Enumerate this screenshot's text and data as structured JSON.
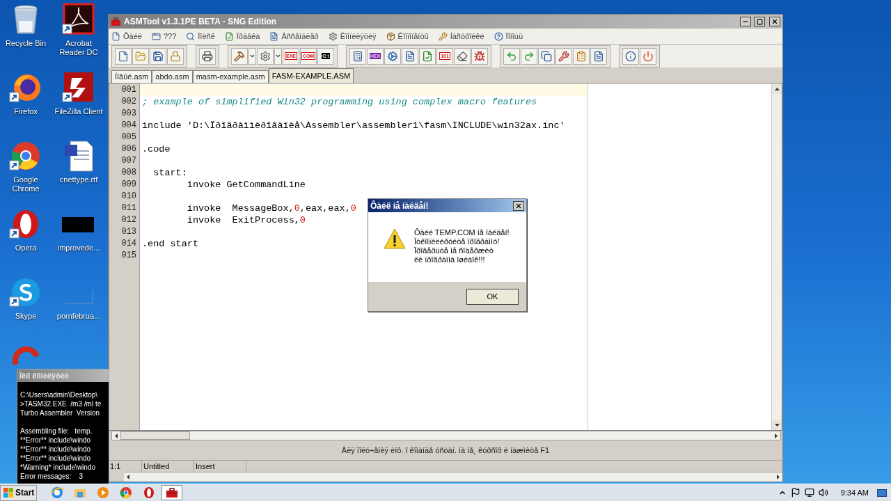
{
  "desktop_icons": [
    {
      "kind": "recycle-bin",
      "label": "Recycle Bin",
      "shortcut": false
    },
    {
      "kind": "pdf",
      "label": "Acrobat Reader DC",
      "shortcut": true
    },
    {
      "kind": "firefox",
      "label": "Firefox",
      "shortcut": true
    },
    {
      "kind": "filezilla",
      "label": "FileZilla Client",
      "shortcut": true
    },
    {
      "kind": "chrome",
      "label": "Google Chrome",
      "shortcut": true
    },
    {
      "kind": "word",
      "label": "cnettype.rtf",
      "shortcut": false
    },
    {
      "kind": "opera",
      "label": "Opera",
      "shortcut": true
    },
    {
      "kind": "black-file",
      "label": "improvede...",
      "shortcut": false
    },
    {
      "kind": "skype",
      "label": "Skype",
      "shortcut": true
    },
    {
      "kind": "blank-file",
      "label": "pornfebrua...",
      "shortcut": false
    },
    {
      "kind": "cleaner"
    }
  ],
  "editor_window": {
    "title": "ASMTool v1.3.1PE BETA - SNG Edition",
    "menu": [
      {
        "kind": "file",
        "label": "Ôàéë"
      },
      {
        "kind": "window",
        "label": "???"
      },
      {
        "kind": "search",
        "label": "Ïîèñê"
      },
      {
        "kind": "edit",
        "label": "Ïðàâêà"
      },
      {
        "kind": "assembler",
        "label": "Àññåìáëåð"
      },
      {
        "kind": "compile",
        "label": "Êîìïèëÿöèÿ"
      },
      {
        "kind": "components",
        "label": "Êîìïîíåíòû"
      },
      {
        "kind": "tools",
        "label": "Íàñòðîéêè"
      },
      {
        "kind": "help",
        "label": "Ïîìîùü"
      }
    ],
    "toolbar": [
      [
        {
          "kind": "new"
        },
        {
          "kind": "open"
        },
        {
          "kind": "save"
        },
        {
          "kind": "properties"
        }
      ],
      [
        {
          "kind": "print"
        }
      ],
      [
        {
          "kind": "build"
        },
        {
          "kind": "dropdown"
        },
        {
          "kind": "settings"
        },
        {
          "kind": "dropdown"
        },
        {
          "kind": "exe",
          "label": "EXE"
        },
        {
          "kind": "com",
          "label": "COM"
        },
        {
          "kind": "console",
          "label": "C:\\"
        }
      ],
      [
        {
          "kind": "calculator"
        },
        {
          "kind": "hex",
          "label": "HEX"
        },
        {
          "kind": "gear"
        },
        {
          "kind": "document"
        },
        {
          "kind": "check"
        },
        {
          "kind": "binary",
          "label": "101"
        },
        {
          "kind": "eraser"
        },
        {
          "kind": "bug"
        }
      ],
      [
        {
          "kind": "undo"
        },
        {
          "kind": "redo"
        },
        {
          "kind": "copy"
        },
        {
          "kind": "tools"
        },
        {
          "kind": "clipboard"
        },
        {
          "kind": "document"
        }
      ],
      [
        {
          "kind": "info"
        },
        {
          "kind": "power"
        }
      ]
    ],
    "tabs": [
      {
        "label": "Íîâûé.asm",
        "selected": false
      },
      {
        "label": "abdo.asm",
        "selected": false
      },
      {
        "label": "masm-example.asm",
        "selected": false
      },
      {
        "label": "FASM-EXAMPLE.ASM",
        "selected": true
      }
    ],
    "lines": [
      {
        "number": "001",
        "current": true
      },
      {
        "number": "002",
        "current": false,
        "tokens": [
          {
            "kind": "comment",
            "text": "; example of simplified Win32 programming using complex macro features"
          }
        ]
      },
      {
        "number": "003",
        "current": false
      },
      {
        "number": "004",
        "current": false,
        "tokens": [
          {
            "kind": "plain",
            "text": "include 'D:\\Ïðîãðàììèðîâàíèå\\Assembler\\assembler1\\fasm\\INCLUDE\\win32ax.inc'"
          }
        ]
      },
      {
        "number": "005",
        "current": false
      },
      {
        "number": "006",
        "current": false,
        "tokens": [
          {
            "kind": "plain",
            "text": ".code"
          }
        ]
      },
      {
        "number": "007",
        "current": false
      },
      {
        "number": "008",
        "current": false,
        "tokens": [
          {
            "kind": "plain",
            "text": "  start:"
          }
        ]
      },
      {
        "number": "009",
        "current": false,
        "tokens": [
          {
            "kind": "plain",
            "text": "        invoke GetCommandLine"
          }
        ]
      },
      {
        "number": "010",
        "current": false
      },
      {
        "number": "011",
        "current": false,
        "tokens": [
          {
            "kind": "plain",
            "text": "        invoke  MessageBox,"
          },
          {
            "kind": "number",
            "text": "0"
          },
          {
            "kind": "plain",
            "text": ",eax,eax,"
          },
          {
            "kind": "number",
            "text": "0"
          }
        ]
      },
      {
        "number": "012",
        "current": false,
        "tokens": [
          {
            "kind": "plain",
            "text": "        invoke  ExitProcess,"
          },
          {
            "kind": "number",
            "text": "0"
          }
        ]
      },
      {
        "number": "013",
        "current": false
      },
      {
        "number": "014",
        "current": false,
        "tokens": [
          {
            "kind": "plain",
            "text": ".end start"
          }
        ]
      },
      {
        "number": "015",
        "current": false
      }
    ],
    "hint": "Äëÿ ïîëó÷åíèÿ èíô. î êîìàíäå óñòàí. íà íå¸ êóðñîð è íàæìèòå F1",
    "status": [
      "1:1",
      "Untitled",
      "Insert"
    ]
  },
  "compile_window": {
    "title": "Îêíî êîìïèëÿöèè",
    "output": "C:\\Users\\admin\\Desktop\\\n>TASM32.EXE  /m3 /ml te\nTurbo Assembler  Version\n\nAssembling file:   temp.\n**Error** include\\windo\n**Error** include\\windo\n**Error** include\\windo\n*Warning* include\\windo\nError messages:    3"
  },
  "dialog": {
    "title": "Ôàéë íå íàéäåí!",
    "message": "Ôàéë TEMP.COM íå íàéäåí!\nÎòêîìïèëèðóéòå ïðîãðàììó!\nÏðîâåðüòå íå ñîäåðæèò\nëè ïðîãðàììà îøèáîê!!!",
    "button": "OK"
  },
  "taskbar": {
    "start": "Start",
    "tasks": [
      {
        "kind": "ie",
        "selected": false
      },
      {
        "kind": "explorer",
        "selected": false
      },
      {
        "kind": "media",
        "selected": false
      },
      {
        "kind": "chrome",
        "selected": false
      },
      {
        "kind": "opera",
        "selected": false
      },
      {
        "kind": "asmtool",
        "selected": true
      }
    ],
    "clock": "9:34 AM"
  }
}
